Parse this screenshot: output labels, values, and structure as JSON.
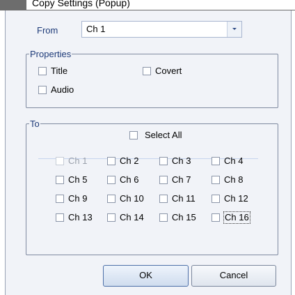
{
  "window": {
    "caption": "Copy Settings (Popup)"
  },
  "from": {
    "label": "From",
    "value": "Ch 1"
  },
  "properties": {
    "legend": "Properties",
    "options": [
      {
        "label": "Title",
        "checked": false
      },
      {
        "label": "Covert",
        "checked": false
      },
      {
        "label": "Audio",
        "checked": false
      }
    ]
  },
  "to": {
    "legend": "To",
    "select_all": "Select All",
    "channels": [
      "Ch 1",
      "Ch 2",
      "Ch 3",
      "Ch 4",
      "Ch 5",
      "Ch 6",
      "Ch 7",
      "Ch 8",
      "Ch 9",
      "Ch 10",
      "Ch 11",
      "Ch 12",
      "Ch 13",
      "Ch 14",
      "Ch 15",
      "Ch 16"
    ],
    "disabled_channel": "Ch 1",
    "focused_channel": "Ch 16"
  },
  "buttons": {
    "ok": "OK",
    "cancel": "Cancel"
  },
  "colors": {
    "client_bg": "#f1f3f8",
    "label_blue": "#1d3a78",
    "ok_border": "#4c6fa8"
  }
}
